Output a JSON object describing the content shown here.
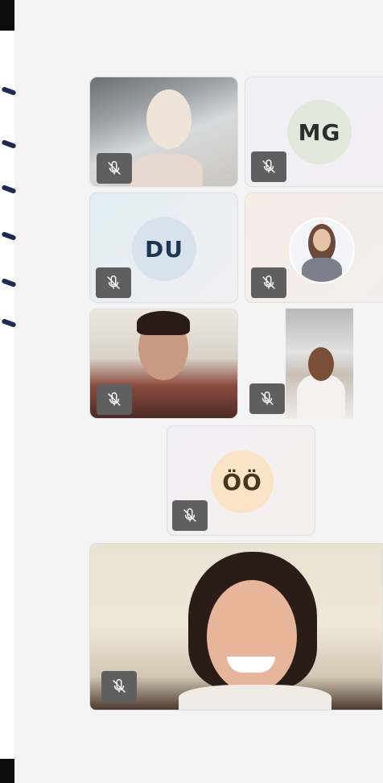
{
  "participants": [
    {
      "id": "p1",
      "type": "video",
      "muted": true
    },
    {
      "id": "p2",
      "type": "initials",
      "initials": "MG",
      "muted": true,
      "avatar_color": "#e3e8dc",
      "text_color": "#2d2d2d"
    },
    {
      "id": "p3",
      "type": "initials",
      "initials": "DU",
      "muted": true,
      "avatar_color": "#d8e2ec",
      "text_color": "#1f3556"
    },
    {
      "id": "p4",
      "type": "photo-avatar",
      "muted": true
    },
    {
      "id": "p5",
      "type": "video",
      "muted": true
    },
    {
      "id": "p6",
      "type": "video",
      "muted": true
    },
    {
      "id": "p7",
      "type": "initials",
      "initials": "ÖÖ",
      "muted": true,
      "avatar_color": "#fbe3c8",
      "text_color": "#4a3520"
    },
    {
      "id": "p8",
      "type": "video",
      "muted": true
    }
  ],
  "icons": {
    "mic": "microphone-off-icon"
  },
  "colors": {
    "mic_bg": "#5f5f5f",
    "stage_bg": "#f3f3f3",
    "accent_dashes": "#1d2a55"
  }
}
